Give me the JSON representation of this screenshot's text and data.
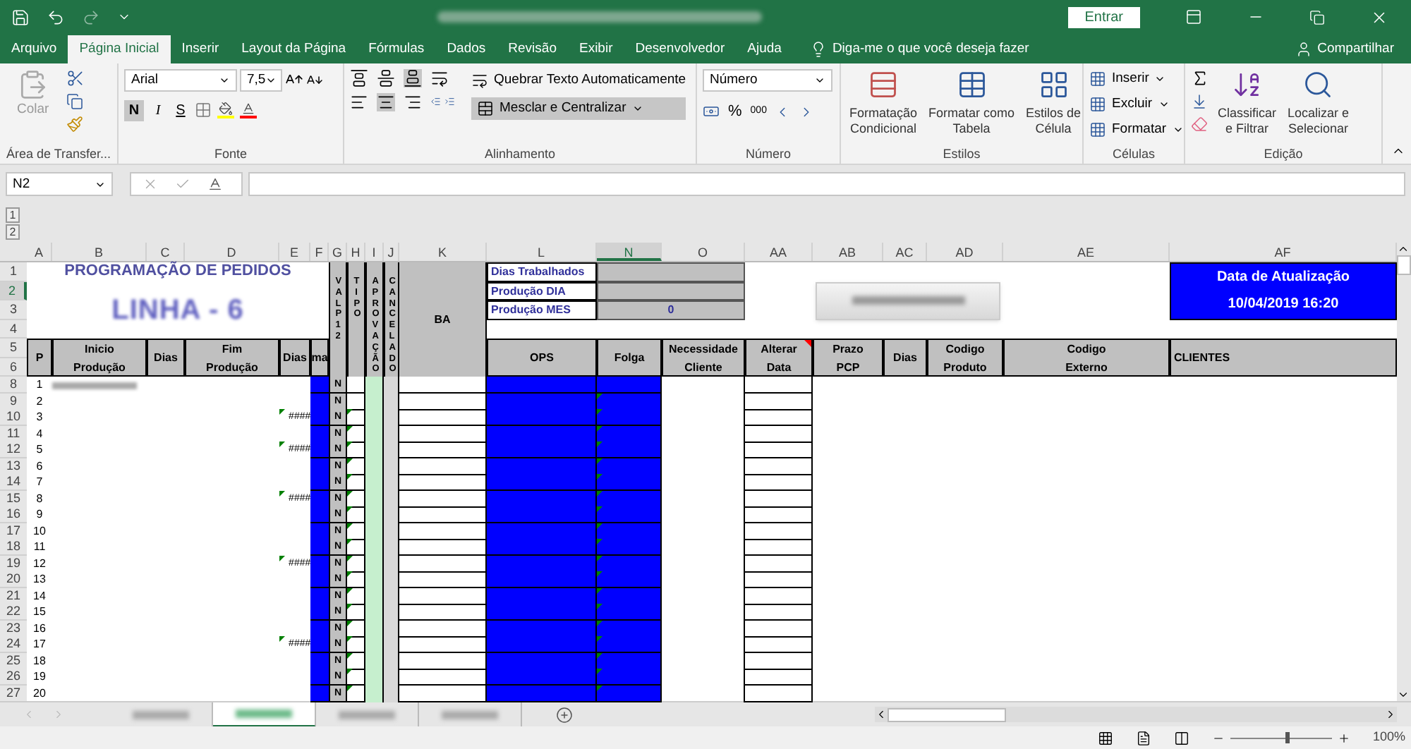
{
  "title_bar": {
    "sign_in": "Entrar"
  },
  "menu_tabs": [
    {
      "label": "Arquivo",
      "selected": false
    },
    {
      "label": "Página Inicial",
      "selected": true
    },
    {
      "label": "Inserir",
      "selected": false
    },
    {
      "label": "Layout da Página",
      "selected": false
    },
    {
      "label": "Fórmulas",
      "selected": false
    },
    {
      "label": "Dados",
      "selected": false
    },
    {
      "label": "Revisão",
      "selected": false
    },
    {
      "label": "Exibir",
      "selected": false
    },
    {
      "label": "Desenvolvedor",
      "selected": false
    },
    {
      "label": "Ajuda",
      "selected": false
    }
  ],
  "tell_me": "Diga-me o que você deseja fazer",
  "share": "Compartilhar",
  "ribbon": {
    "clipboard": {
      "paste": "Colar",
      "group": "Área de Transfer..."
    },
    "font": {
      "family": "Arial",
      "size": "7,5",
      "bold": "N",
      "italic": "I",
      "underline": "S",
      "bold_on": true,
      "group": "Fonte"
    },
    "alignment": {
      "wrap": "Quebrar Texto Automaticamente",
      "merge": "Mesclar e Centralizar",
      "merge_on": true,
      "center_on": true,
      "bottom_on": true,
      "group": "Alinhamento"
    },
    "number": {
      "format": "Número",
      "percent": "%",
      "thousands": "000",
      "group": "Número"
    },
    "styles": {
      "items": [
        "Formatação\nCondicional",
        "Formatar como\nTabela",
        "Estilos de\nCélula"
      ],
      "group": "Estilos"
    },
    "cells": {
      "items": [
        "Inserir",
        "Excluir",
        "Formatar"
      ],
      "group": "Células"
    },
    "editing": {
      "items": [
        "Classificar\ne Filtrar",
        "Localizar e\nSelecionar"
      ],
      "group": "Edição"
    }
  },
  "formula_bar": {
    "name_box": "N2"
  },
  "outline_levels": [
    "1",
    "2"
  ],
  "columns": [
    {
      "label": "A",
      "selected": false
    },
    {
      "label": "B",
      "selected": false
    },
    {
      "label": "C",
      "selected": false
    },
    {
      "label": "D",
      "selected": false
    },
    {
      "label": "E",
      "selected": false
    },
    {
      "label": "F",
      "selected": false
    },
    {
      "label": "G",
      "selected": false
    },
    {
      "label": "H",
      "selected": false
    },
    {
      "label": "I",
      "selected": false
    },
    {
      "label": "J",
      "selected": false
    },
    {
      "label": "K",
      "selected": false
    },
    {
      "label": "L",
      "selected": false
    },
    {
      "label": "N",
      "selected": true
    },
    {
      "label": "O",
      "selected": false
    },
    {
      "label": "AA",
      "selected": false
    },
    {
      "label": "AB",
      "selected": false
    },
    {
      "label": "AC",
      "selected": false
    },
    {
      "label": "AD",
      "selected": false
    },
    {
      "label": "AE",
      "selected": false
    },
    {
      "label": "AF",
      "selected": false
    }
  ],
  "top_rows": [
    {
      "label": "1",
      "selected": false
    },
    {
      "label": "2",
      "selected": true
    },
    {
      "label": "3",
      "selected": false
    },
    {
      "label": "4",
      "selected": false
    },
    {
      "label": "5",
      "selected": false
    },
    {
      "label": "6",
      "selected": false
    }
  ],
  "header_block": {
    "title": "PROGRAMAÇÃO DE PEDIDOS",
    "subtitle": "LINHA - 6",
    "vertical_headers": [
      "VAL P12",
      "TIPO",
      "APROVAÇÃO",
      "CANCELADO"
    ],
    "ba": "BA",
    "summary": [
      {
        "label": "Dias Trabalhados"
      },
      {
        "label": "Produção DIA"
      },
      {
        "label": "Produção MES",
        "value": "0"
      }
    ],
    "update": {
      "title": "Data de Atualização",
      "value": "10/04/2019 16:20"
    }
  },
  "table_headers": [
    {
      "label": "P",
      "has_comment": false
    },
    {
      "label": "Inicio\nProdução",
      "has_comment": false
    },
    {
      "label": "Dias",
      "has_comment": false
    },
    {
      "label": "Fim\nProdução",
      "has_comment": false
    },
    {
      "label": "Dias",
      "has_comment": false
    },
    {
      "label": "ma",
      "has_comment": false
    },
    {
      "label": "OPS",
      "has_comment": false
    },
    {
      "label": "Folga",
      "has_comment": false
    },
    {
      "label": "Necessidade\nCliente",
      "has_comment": false
    },
    {
      "label": "Alterar\nData",
      "has_comment": true
    },
    {
      "label": "Prazo\nPCP",
      "has_comment": false
    },
    {
      "label": "Dias",
      "has_comment": false
    },
    {
      "label": "Codigo\nProduto",
      "has_comment": false
    },
    {
      "label": "Codigo\nExterno",
      "has_comment": false
    },
    {
      "label": "CLIENTES",
      "has_comment": false
    }
  ],
  "rows": [
    {
      "row": "8",
      "p": "1",
      "b_blurred": true,
      "e": "",
      "g": "N",
      "h_flag": false,
      "n_flag": false
    },
    {
      "row": "9",
      "p": "2",
      "b_blurred": false,
      "e": "",
      "g": "N",
      "h_flag": false,
      "n_flag": true
    },
    {
      "row": "10",
      "p": "3",
      "b_blurred": false,
      "e": "####",
      "g": "N",
      "h_flag": true,
      "n_flag": true
    },
    {
      "row": "11",
      "p": "4",
      "b_blurred": false,
      "e": "",
      "g": "N",
      "h_flag": true,
      "n_flag": true
    },
    {
      "row": "12",
      "p": "5",
      "b_blurred": false,
      "e": "####",
      "g": "N",
      "h_flag": true,
      "n_flag": true
    },
    {
      "row": "13",
      "p": "6",
      "b_blurred": false,
      "e": "",
      "g": "N",
      "h_flag": true,
      "n_flag": true
    },
    {
      "row": "14",
      "p": "7",
      "b_blurred": false,
      "e": "",
      "g": "N",
      "h_flag": true,
      "n_flag": true
    },
    {
      "row": "15",
      "p": "8",
      "b_blurred": false,
      "e": "####",
      "g": "N",
      "h_flag": true,
      "n_flag": true
    },
    {
      "row": "16",
      "p": "9",
      "b_blurred": false,
      "e": "",
      "g": "N",
      "h_flag": true,
      "n_flag": true
    },
    {
      "row": "17",
      "p": "10",
      "b_blurred": false,
      "e": "",
      "g": "N",
      "h_flag": true,
      "n_flag": true
    },
    {
      "row": "18",
      "p": "11",
      "b_blurred": false,
      "e": "",
      "g": "N",
      "h_flag": true,
      "n_flag": true
    },
    {
      "row": "19",
      "p": "12",
      "b_blurred": false,
      "e": "####",
      "g": "N",
      "h_flag": true,
      "n_flag": true
    },
    {
      "row": "20",
      "p": "13",
      "b_blurred": false,
      "e": "",
      "g": "N",
      "h_flag": true,
      "n_flag": true
    },
    {
      "row": "21",
      "p": "14",
      "b_blurred": false,
      "e": "",
      "g": "N",
      "h_flag": true,
      "n_flag": true
    },
    {
      "row": "22",
      "p": "15",
      "b_blurred": false,
      "e": "",
      "g": "N",
      "h_flag": true,
      "n_flag": true
    },
    {
      "row": "23",
      "p": "16",
      "b_blurred": false,
      "e": "",
      "g": "N",
      "h_flag": true,
      "n_flag": true
    },
    {
      "row": "24",
      "p": "17",
      "b_blurred": false,
      "e": "####",
      "g": "N",
      "h_flag": true,
      "n_flag": true
    },
    {
      "row": "25",
      "p": "18",
      "b_blurred": false,
      "e": "",
      "g": "N",
      "h_flag": true,
      "n_flag": true
    },
    {
      "row": "26",
      "p": "19",
      "b_blurred": false,
      "e": "",
      "g": "N",
      "h_flag": true,
      "n_flag": true
    },
    {
      "row": "27",
      "p": "20",
      "b_blurred": false,
      "e": "",
      "g": "N",
      "h_flag": true,
      "n_flag": true
    }
  ],
  "sheet_tabs": [
    {
      "selected": false
    },
    {
      "selected": true
    },
    {
      "selected": false
    },
    {
      "selected": false
    }
  ],
  "zoom": {
    "label": "100%",
    "level": 0.55
  }
}
